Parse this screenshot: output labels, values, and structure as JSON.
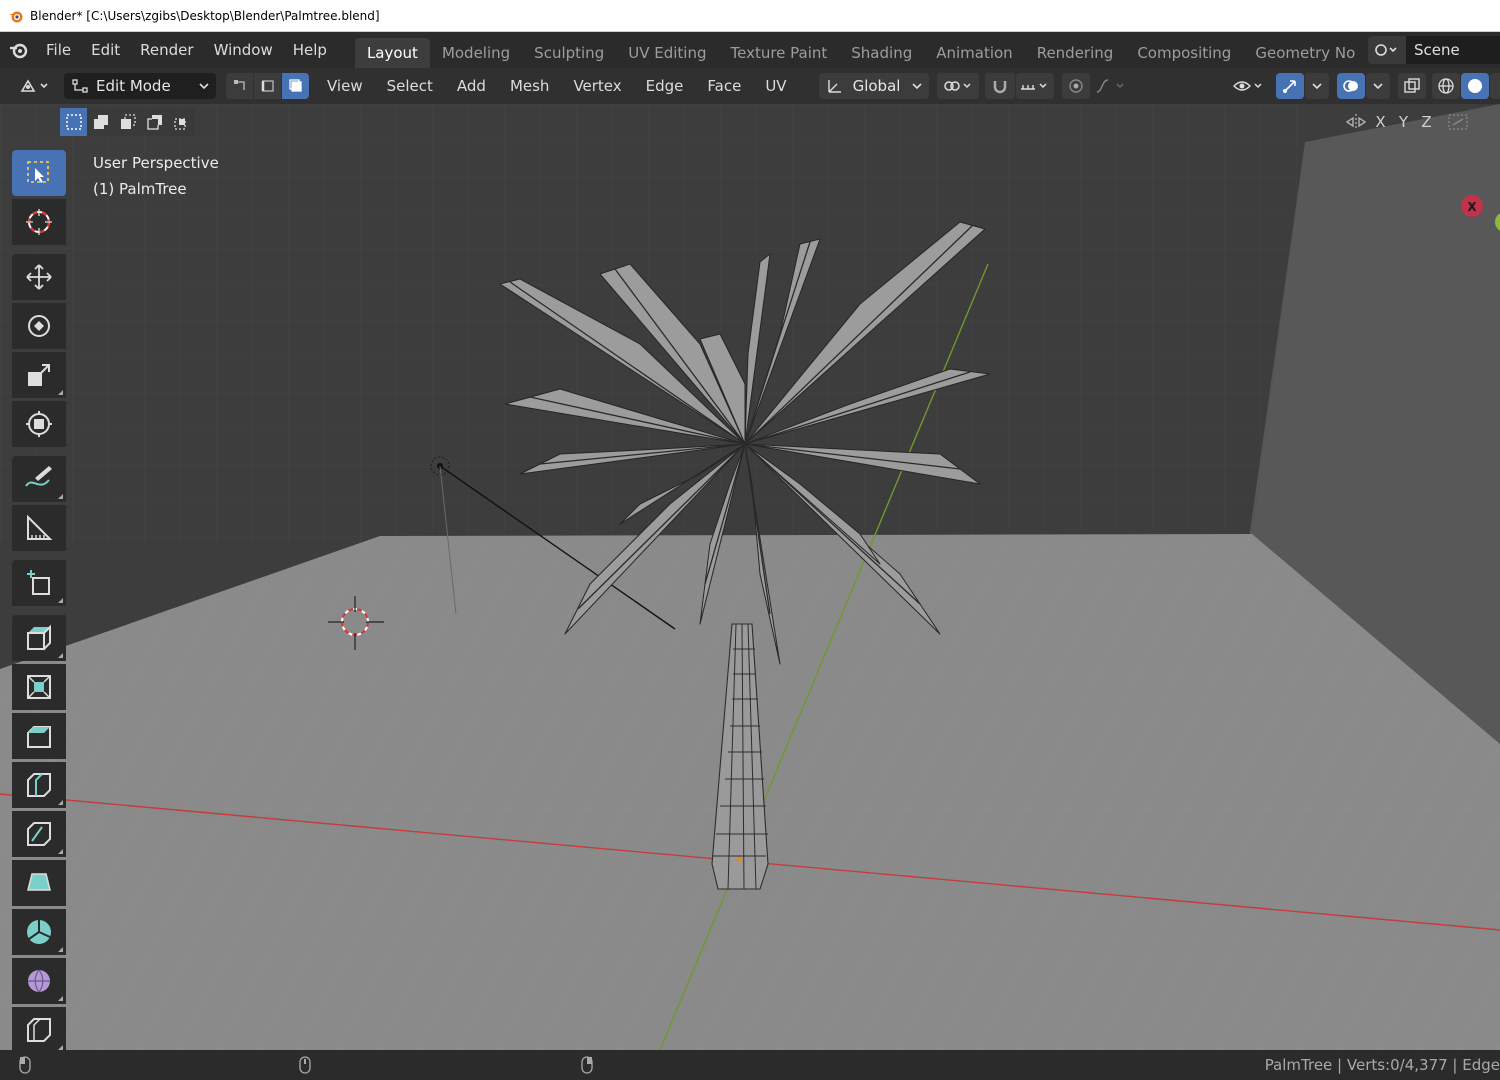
{
  "window": {
    "title": "Blender* [C:\\Users\\zgibs\\Desktop\\Blender\\Palmtree.blend]"
  },
  "menubar": {
    "items": [
      "File",
      "Edit",
      "Render",
      "Window",
      "Help"
    ]
  },
  "workspaces": {
    "tabs": [
      "Layout",
      "Modeling",
      "Sculpting",
      "UV Editing",
      "Texture Paint",
      "Shading",
      "Animation",
      "Rendering",
      "Compositing",
      "Geometry No"
    ],
    "active": "Layout"
  },
  "scene": {
    "name": "Scene"
  },
  "header": {
    "mode": "Edit Mode",
    "menus": [
      "View",
      "Select",
      "Add",
      "Mesh",
      "Vertex",
      "Edge",
      "Face",
      "UV"
    ],
    "transform_orientation": "Global"
  },
  "viewport": {
    "view_name": "User Perspective",
    "object_label": "(1) PalmTree",
    "axis_labels": [
      "X",
      "Y",
      "Z"
    ],
    "gizmo_x": "X"
  },
  "toolbar": {
    "tools": [
      "select-box",
      "cursor",
      "move",
      "rotate",
      "scale",
      "transform",
      "annotate",
      "measure",
      "add-cube",
      "extrude-region",
      "inset-faces",
      "bevel",
      "loop-cut",
      "knife",
      "poly-build",
      "spin",
      "smooth",
      "edge-slide"
    ]
  },
  "statusbar": {
    "stats": "PalmTree | Verts:0/4,377 | Edge"
  },
  "colors": {
    "accent": "#4772b3",
    "x_axis": "#c43c3c",
    "y_axis": "#6e9a2c",
    "selection": "#e88a1a"
  }
}
